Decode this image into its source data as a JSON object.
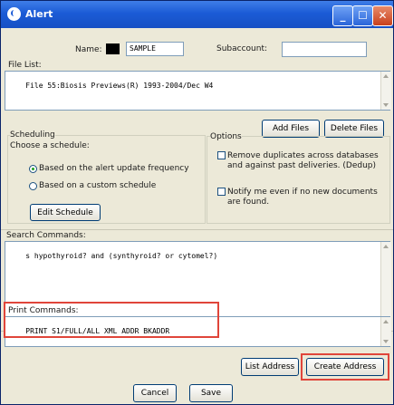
{
  "window": {
    "title": "Alert",
    "icon": "app-logo-icon",
    "controls": {
      "minimize": "_",
      "maximize": "☐",
      "close": "✕"
    }
  },
  "header": {
    "name_label": "Name:",
    "name_value": "SAMPLE",
    "subaccount_label": "Subaccount:",
    "subaccount_value": ""
  },
  "file_list": {
    "label": "File List:",
    "text": "File 55:Biosis Previews(R) 1993-2004/Dec W4"
  },
  "file_buttons": {
    "add": "Add Files",
    "delete": "Delete Files"
  },
  "scheduling": {
    "title": "Scheduling",
    "subtitle": "Choose a schedule:",
    "option_frequency": "Based on the alert update frequency",
    "option_custom": "Based on a custom schedule",
    "selected": "frequency",
    "edit_button": "Edit Schedule"
  },
  "options": {
    "title": "Options",
    "dedup_line1": "Remove duplicates across databases",
    "dedup_line2": "and against past deliveries. (Dedup)",
    "notify_line1": "Notify me even if no new documents",
    "notify_line2": "are found.",
    "dedup_checked": false,
    "notify_checked": false
  },
  "search": {
    "label": "Search Commands:",
    "text": "s hypothyroid? and (synthyroid? or cytomel?)"
  },
  "print": {
    "label": "Print Commands:",
    "text": "PRINT S1/FULL/ALL XML ADDR BKADDR"
  },
  "address_buttons": {
    "list": "List Address",
    "create": "Create Address"
  },
  "footer_buttons": {
    "cancel": "Cancel",
    "save": "Save"
  },
  "colors": {
    "highlight": "#e0453a",
    "titlebar": "#1b5bd6",
    "dialog_bg": "#ece9d8"
  }
}
